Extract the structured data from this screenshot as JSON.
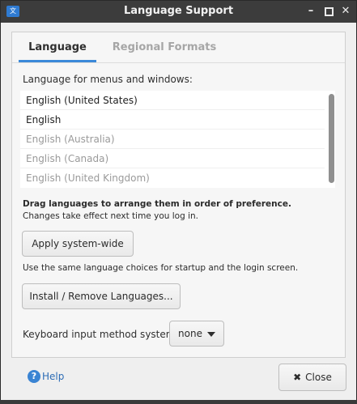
{
  "window": {
    "title": "Language Support",
    "app_icon_glyph": "文",
    "controls": {
      "minimize": "–",
      "close": "✕"
    }
  },
  "tabs": [
    {
      "label": "Language",
      "selected": true
    },
    {
      "label": "Regional Formats",
      "selected": false
    }
  ],
  "language_section": {
    "label": "Language for menus and windows:",
    "languages": [
      {
        "name": "English (United States)",
        "active": true
      },
      {
        "name": "English",
        "active": true
      },
      {
        "name": "English (Australia)",
        "active": false
      },
      {
        "name": "English (Canada)",
        "active": false
      },
      {
        "name": "English (United Kingdom)",
        "active": false
      }
    ],
    "hint_bold": "Drag languages to arrange them in order of preference.",
    "hint": "Changes take effect next time you log in."
  },
  "apply": {
    "button_label": "Apply system-wide",
    "note": "Use the same language choices for startup and the login screen."
  },
  "install": {
    "button_label": "Install / Remove Languages..."
  },
  "keyboard": {
    "label": "Keyboard input method system:",
    "value": "none"
  },
  "footer": {
    "help_icon_glyph": "?",
    "help_label": "Help",
    "close_label": "Close",
    "close_glyph": "✖"
  },
  "colors": {
    "accent": "#3b89d9",
    "titlebar": "#3c3c3c",
    "help_link": "#2d6cb5"
  }
}
